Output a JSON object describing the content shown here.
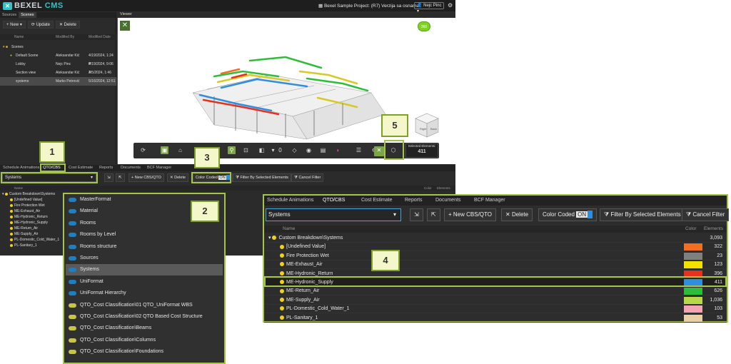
{
  "app": {
    "logo_text": "BEXEL",
    "logo_suffix": "CMS",
    "project": "Bexel Sample Project: (R7) Verzija sa osnama",
    "user": "Nejc Pinc"
  },
  "left_panel": {
    "tabs": [
      "Sources",
      "Scenes"
    ],
    "toolbar": {
      "new": "New",
      "update": "Update",
      "delete": "Delete"
    },
    "columns": [
      "Name",
      "Modified By",
      "Modified Date"
    ],
    "rows": [
      {
        "name": "Scenes",
        "by": "",
        "date": ""
      },
      {
        "name": "Default Scene",
        "by": "Aleksandar Kić",
        "date": "4/19/2024, 1:24 P"
      },
      {
        "name": "Lobby",
        "by": "Nejc Pinc",
        "date": "4/19/2024, 9:06 A"
      },
      {
        "name": "Section view",
        "by": "Aleksandar Kić",
        "date": "7/5/2024, 1:46 PM"
      },
      {
        "name": "systems",
        "by": "Marko Petrović",
        "date": "5/16/2024, 12:51"
      }
    ],
    "extra_dates": [
      "4/19/2024, 9:06 A"
    ]
  },
  "viewer": {
    "tab": "Viewer",
    "badge": "360",
    "selected_label": "Selected Elements:",
    "selected_count": "411",
    "toolbar_zero": "0"
  },
  "callouts": [
    "1",
    "2",
    "3",
    "4",
    "5"
  ],
  "bottom_panel": {
    "tabs": [
      "Schedule Animations",
      "QTO/CBS",
      "Cost Estimate",
      "Reports",
      "Documents",
      "BCF Manager"
    ],
    "dropdown_value": "Systems",
    "buttons": {
      "new": "New CBS/QTO",
      "delete": "Delete",
      "color_coded": "Color Coded",
      "on": "ON",
      "filter": "Filter By Selected Elements",
      "cancel": "Cancel Filter"
    },
    "tree_header": "Name",
    "col_color": "Color",
    "col_elements": "Elements",
    "tree": [
      "Custom Breakdown\\Systems",
      "[Undefined Value]",
      "Fire Protection Wet",
      "ME-Exhaust_Air",
      "ME-Hydronic_Return",
      "ME-Hydronic_Supply",
      "ME-Return_Air",
      "ME-Supply_Air",
      "PL-Domestic_Cold_Water_1",
      "PL-Sanitary_1"
    ]
  },
  "dropdown_list": [
    "MasterFormat",
    "Material",
    "Rooms",
    "Rooms by Level",
    "Rooms structure",
    "Sources",
    "Systems",
    "UniFormat",
    "UniFormat Hierarchy",
    "QTO_Cost Classification\\01 QTO_UniFormat WBS",
    "QTO_Cost Classification\\02 QTO Based Cost Structure",
    "QTO_Cost Classification\\Beams",
    "QTO_Cost Classification\\Columns",
    "QTO_Cost Classification\\Foundations"
  ],
  "zoom_panel": {
    "tabs": [
      "Schedule Animations",
      "QTO/CBS",
      "Cost Estimate",
      "Reports",
      "Documents",
      "BCF Manager"
    ],
    "dropdown_value": "Systems",
    "buttons": {
      "new": "New CBS/QTO",
      "delete": "Delete",
      "color_coded": "Color Coded",
      "on": "ON",
      "filter": "Filter By Selected Elements",
      "cancel": "Cancel Filter"
    },
    "header": {
      "name": "Name",
      "color": "Color",
      "elements": "Elements"
    },
    "rows": [
      {
        "name": "Custom Breakdown\\Systems",
        "color": "",
        "count": "3,093"
      },
      {
        "name": "[Undefined Value]",
        "color": "#f07020",
        "count": "322"
      },
      {
        "name": "Fire Protection Wet",
        "color": "#808080",
        "count": "23"
      },
      {
        "name": "ME-Exhaust_Air",
        "color": "#f5e000",
        "count": "123"
      },
      {
        "name": "ME-Hydronic_Return",
        "color": "#e8301c",
        "count": "396"
      },
      {
        "name": "ME-Hydronic_Supply",
        "color": "#2f8ee0",
        "count": "411"
      },
      {
        "name": "ME-Return_Air",
        "color": "#2ebd3a",
        "count": "626"
      },
      {
        "name": "ME-Supply_Air",
        "color": "#b8d84a",
        "count": "1,036"
      },
      {
        "name": "PL-Domestic_Cold_Water_1",
        "color": "#f4a3b4",
        "count": "103"
      },
      {
        "name": "PL-Sanitary_1",
        "color": "#e8cfa4",
        "count": "53"
      }
    ]
  }
}
